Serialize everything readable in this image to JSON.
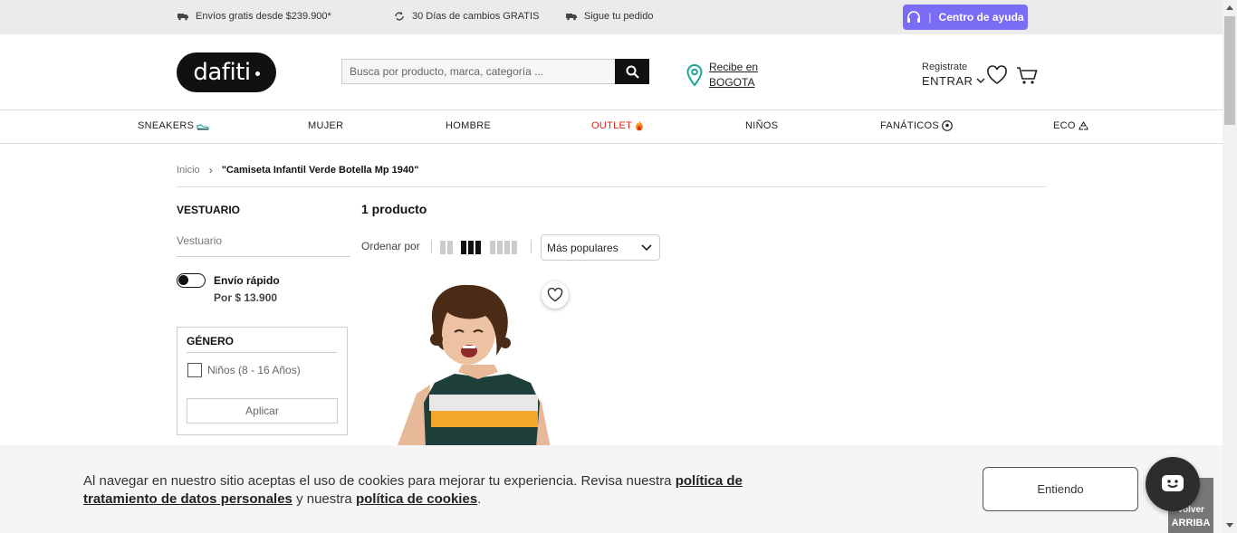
{
  "topbar": {
    "promos": [
      "Envíos gratis desde $239.900*",
      "30 Días de cambios GRATIS",
      "Sigue tu pedido"
    ],
    "help_button": "Centro de ayuda",
    "help_sep": "|"
  },
  "header": {
    "logo": "dafiti",
    "search_placeholder": "Busca por producto, marca, categoría ...",
    "location_line1": "Recibe en",
    "location_line2": "BOGOTA",
    "register": "Registrate",
    "login": "ENTRAR"
  },
  "nav": [
    {
      "label": "SNEAKERS",
      "icon": "sneaker-icon"
    },
    {
      "label": "MUJER",
      "icon": ""
    },
    {
      "label": "HOMBRE",
      "icon": ""
    },
    {
      "label": "OUTLET",
      "icon": "fire-icon"
    },
    {
      "label": "NIÑOS",
      "icon": ""
    },
    {
      "label": "FANÁTICOS",
      "icon": "soccer-ball-icon"
    },
    {
      "label": "ECO",
      "icon": "recycle-icon"
    }
  ],
  "breadcrumb": {
    "home": "Inicio",
    "separator": "›",
    "current": "\"Camiseta Infantil Verde Botella Mp 1940\""
  },
  "sidebar": {
    "section_title": "VESTUARIO",
    "section_sub": "Vestuario",
    "fast_shipping_label": "Envío rápido",
    "fast_shipping_price": "Por $ 13.900",
    "fast_shipping_on": false,
    "filter_title": "GÉNERO",
    "filter_option": "Niños (8 - 16 Años)",
    "apply_button": "Aplicar"
  },
  "results": {
    "count": "1 producto",
    "sort_label": "Ordenar por",
    "sort_value": "Más populares"
  },
  "cookie": {
    "text_before": "Al navegar en nuestro sitio aceptas el uso de cookies para mejorar tu experiencia. Revisa nuestra ",
    "link1": "política de tratamiento de datos personales",
    "text_mid": " y nuestra ",
    "link2": "política de cookies",
    "text_end": ".",
    "button": "Entiendo"
  },
  "back_to_top": {
    "line1": "Volver",
    "line2": "ARRIBA"
  },
  "colors": {
    "help_button": "#7b6cf6",
    "outlet": "#e0261a",
    "location_pin": "#1aa59a"
  }
}
